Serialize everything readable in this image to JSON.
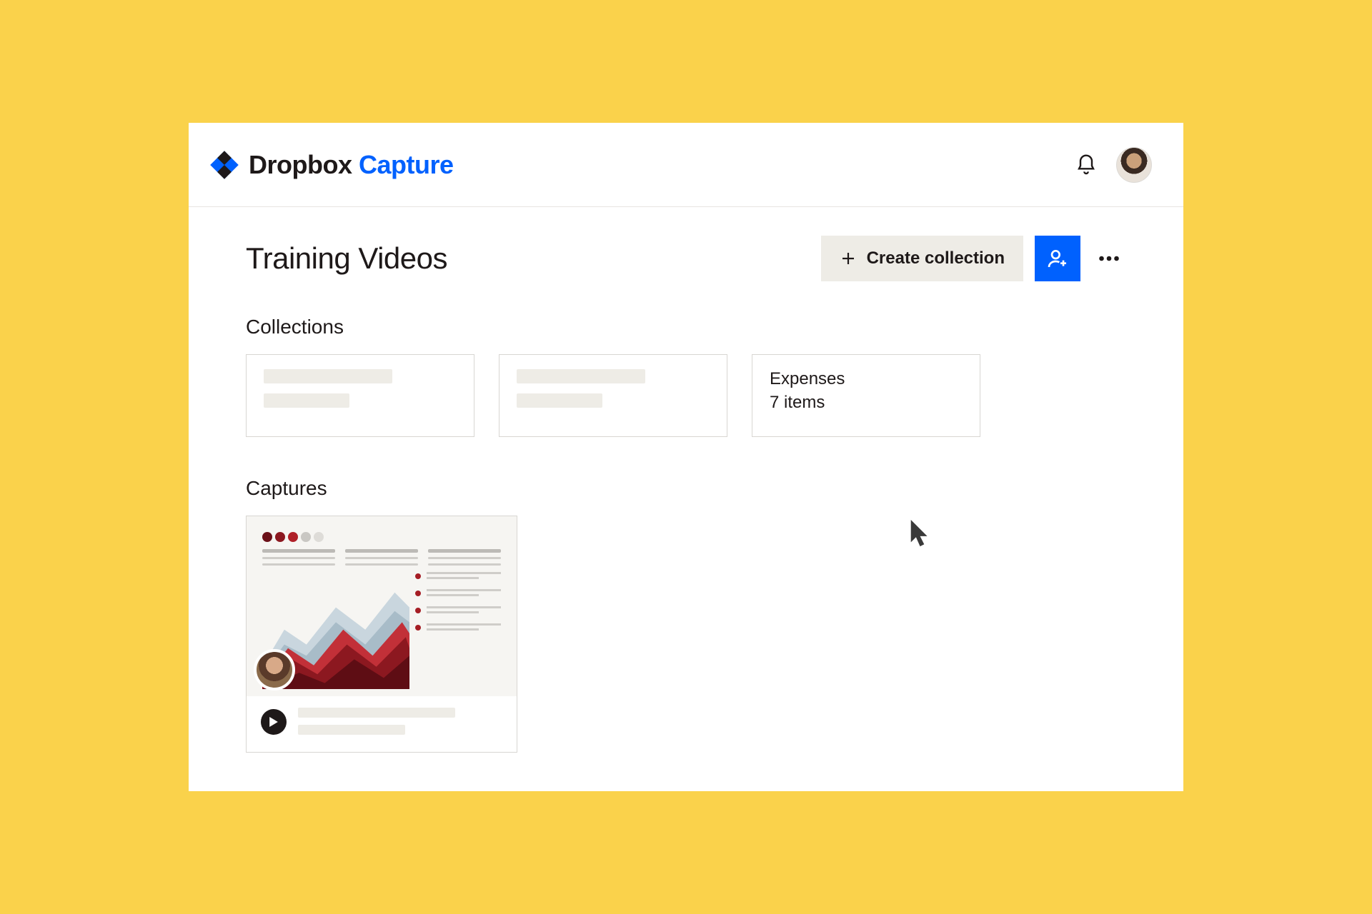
{
  "brand": {
    "name": "Dropbox",
    "product": "Capture"
  },
  "page": {
    "title": "Training Videos"
  },
  "actions": {
    "create_label": "Create collection"
  },
  "sections": {
    "collections_heading": "Collections",
    "captures_heading": "Captures"
  },
  "collections": [
    {
      "name": "",
      "count": "",
      "placeholder": true
    },
    {
      "name": "",
      "count": "",
      "placeholder": true
    },
    {
      "name": "Expenses",
      "count": "7 items",
      "placeholder": false
    }
  ],
  "colors": {
    "accent": "#0061fe",
    "surface": "#ffffff",
    "canvas": "#fad24b"
  }
}
